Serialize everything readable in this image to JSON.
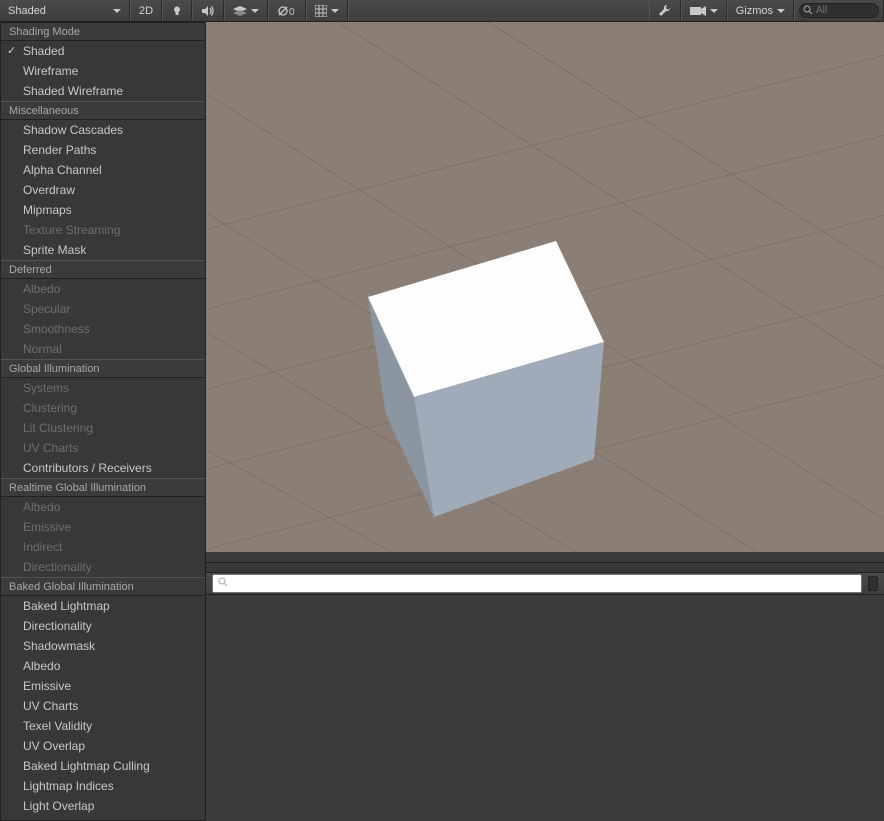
{
  "toolbar": {
    "draw_mode": "Shaded",
    "view_2d": "2D",
    "fx_count": "0",
    "gizmos_label": "Gizmos",
    "search_placeholder": "All"
  },
  "dropdown": {
    "sections": [
      {
        "title": "Shading Mode",
        "items": [
          {
            "label": "Shaded",
            "checked": true,
            "disabled": false
          },
          {
            "label": "Wireframe",
            "checked": false,
            "disabled": false
          },
          {
            "label": "Shaded Wireframe",
            "checked": false,
            "disabled": false
          }
        ]
      },
      {
        "title": "Miscellaneous",
        "items": [
          {
            "label": "Shadow Cascades",
            "checked": false,
            "disabled": false
          },
          {
            "label": "Render Paths",
            "checked": false,
            "disabled": false
          },
          {
            "label": "Alpha Channel",
            "checked": false,
            "disabled": false
          },
          {
            "label": "Overdraw",
            "checked": false,
            "disabled": false
          },
          {
            "label": "Mipmaps",
            "checked": false,
            "disabled": false
          },
          {
            "label": "Texture Streaming",
            "checked": false,
            "disabled": true
          },
          {
            "label": "Sprite Mask",
            "checked": false,
            "disabled": false
          }
        ]
      },
      {
        "title": "Deferred",
        "items": [
          {
            "label": "Albedo",
            "checked": false,
            "disabled": true
          },
          {
            "label": "Specular",
            "checked": false,
            "disabled": true
          },
          {
            "label": "Smoothness",
            "checked": false,
            "disabled": true
          },
          {
            "label": "Normal",
            "checked": false,
            "disabled": true
          }
        ]
      },
      {
        "title": "Global Illumination",
        "items": [
          {
            "label": "Systems",
            "checked": false,
            "disabled": true
          },
          {
            "label": "Clustering",
            "checked": false,
            "disabled": true
          },
          {
            "label": "Lit Clustering",
            "checked": false,
            "disabled": true
          },
          {
            "label": "UV Charts",
            "checked": false,
            "disabled": true
          },
          {
            "label": "Contributors / Receivers",
            "checked": false,
            "disabled": false
          }
        ]
      },
      {
        "title": "Realtime Global Illumination",
        "items": [
          {
            "label": "Albedo",
            "checked": false,
            "disabled": true
          },
          {
            "label": "Emissive",
            "checked": false,
            "disabled": true
          },
          {
            "label": "Indirect",
            "checked": false,
            "disabled": true
          },
          {
            "label": "Directionality",
            "checked": false,
            "disabled": true
          }
        ]
      },
      {
        "title": "Baked Global Illumination",
        "items": [
          {
            "label": "Baked Lightmap",
            "checked": false,
            "disabled": false
          },
          {
            "label": "Directionality",
            "checked": false,
            "disabled": false
          },
          {
            "label": "Shadowmask",
            "checked": false,
            "disabled": false
          },
          {
            "label": "Albedo",
            "checked": false,
            "disabled": false
          },
          {
            "label": "Emissive",
            "checked": false,
            "disabled": false
          },
          {
            "label": "UV Charts",
            "checked": false,
            "disabled": false
          },
          {
            "label": "Texel Validity",
            "checked": false,
            "disabled": false
          },
          {
            "label": "UV Overlap",
            "checked": false,
            "disabled": false
          },
          {
            "label": "Baked Lightmap Culling",
            "checked": false,
            "disabled": false
          },
          {
            "label": "Lightmap Indices",
            "checked": false,
            "disabled": false
          },
          {
            "label": "Light Overlap",
            "checked": false,
            "disabled": false
          }
        ]
      }
    ]
  },
  "bottom_search_placeholder": ""
}
